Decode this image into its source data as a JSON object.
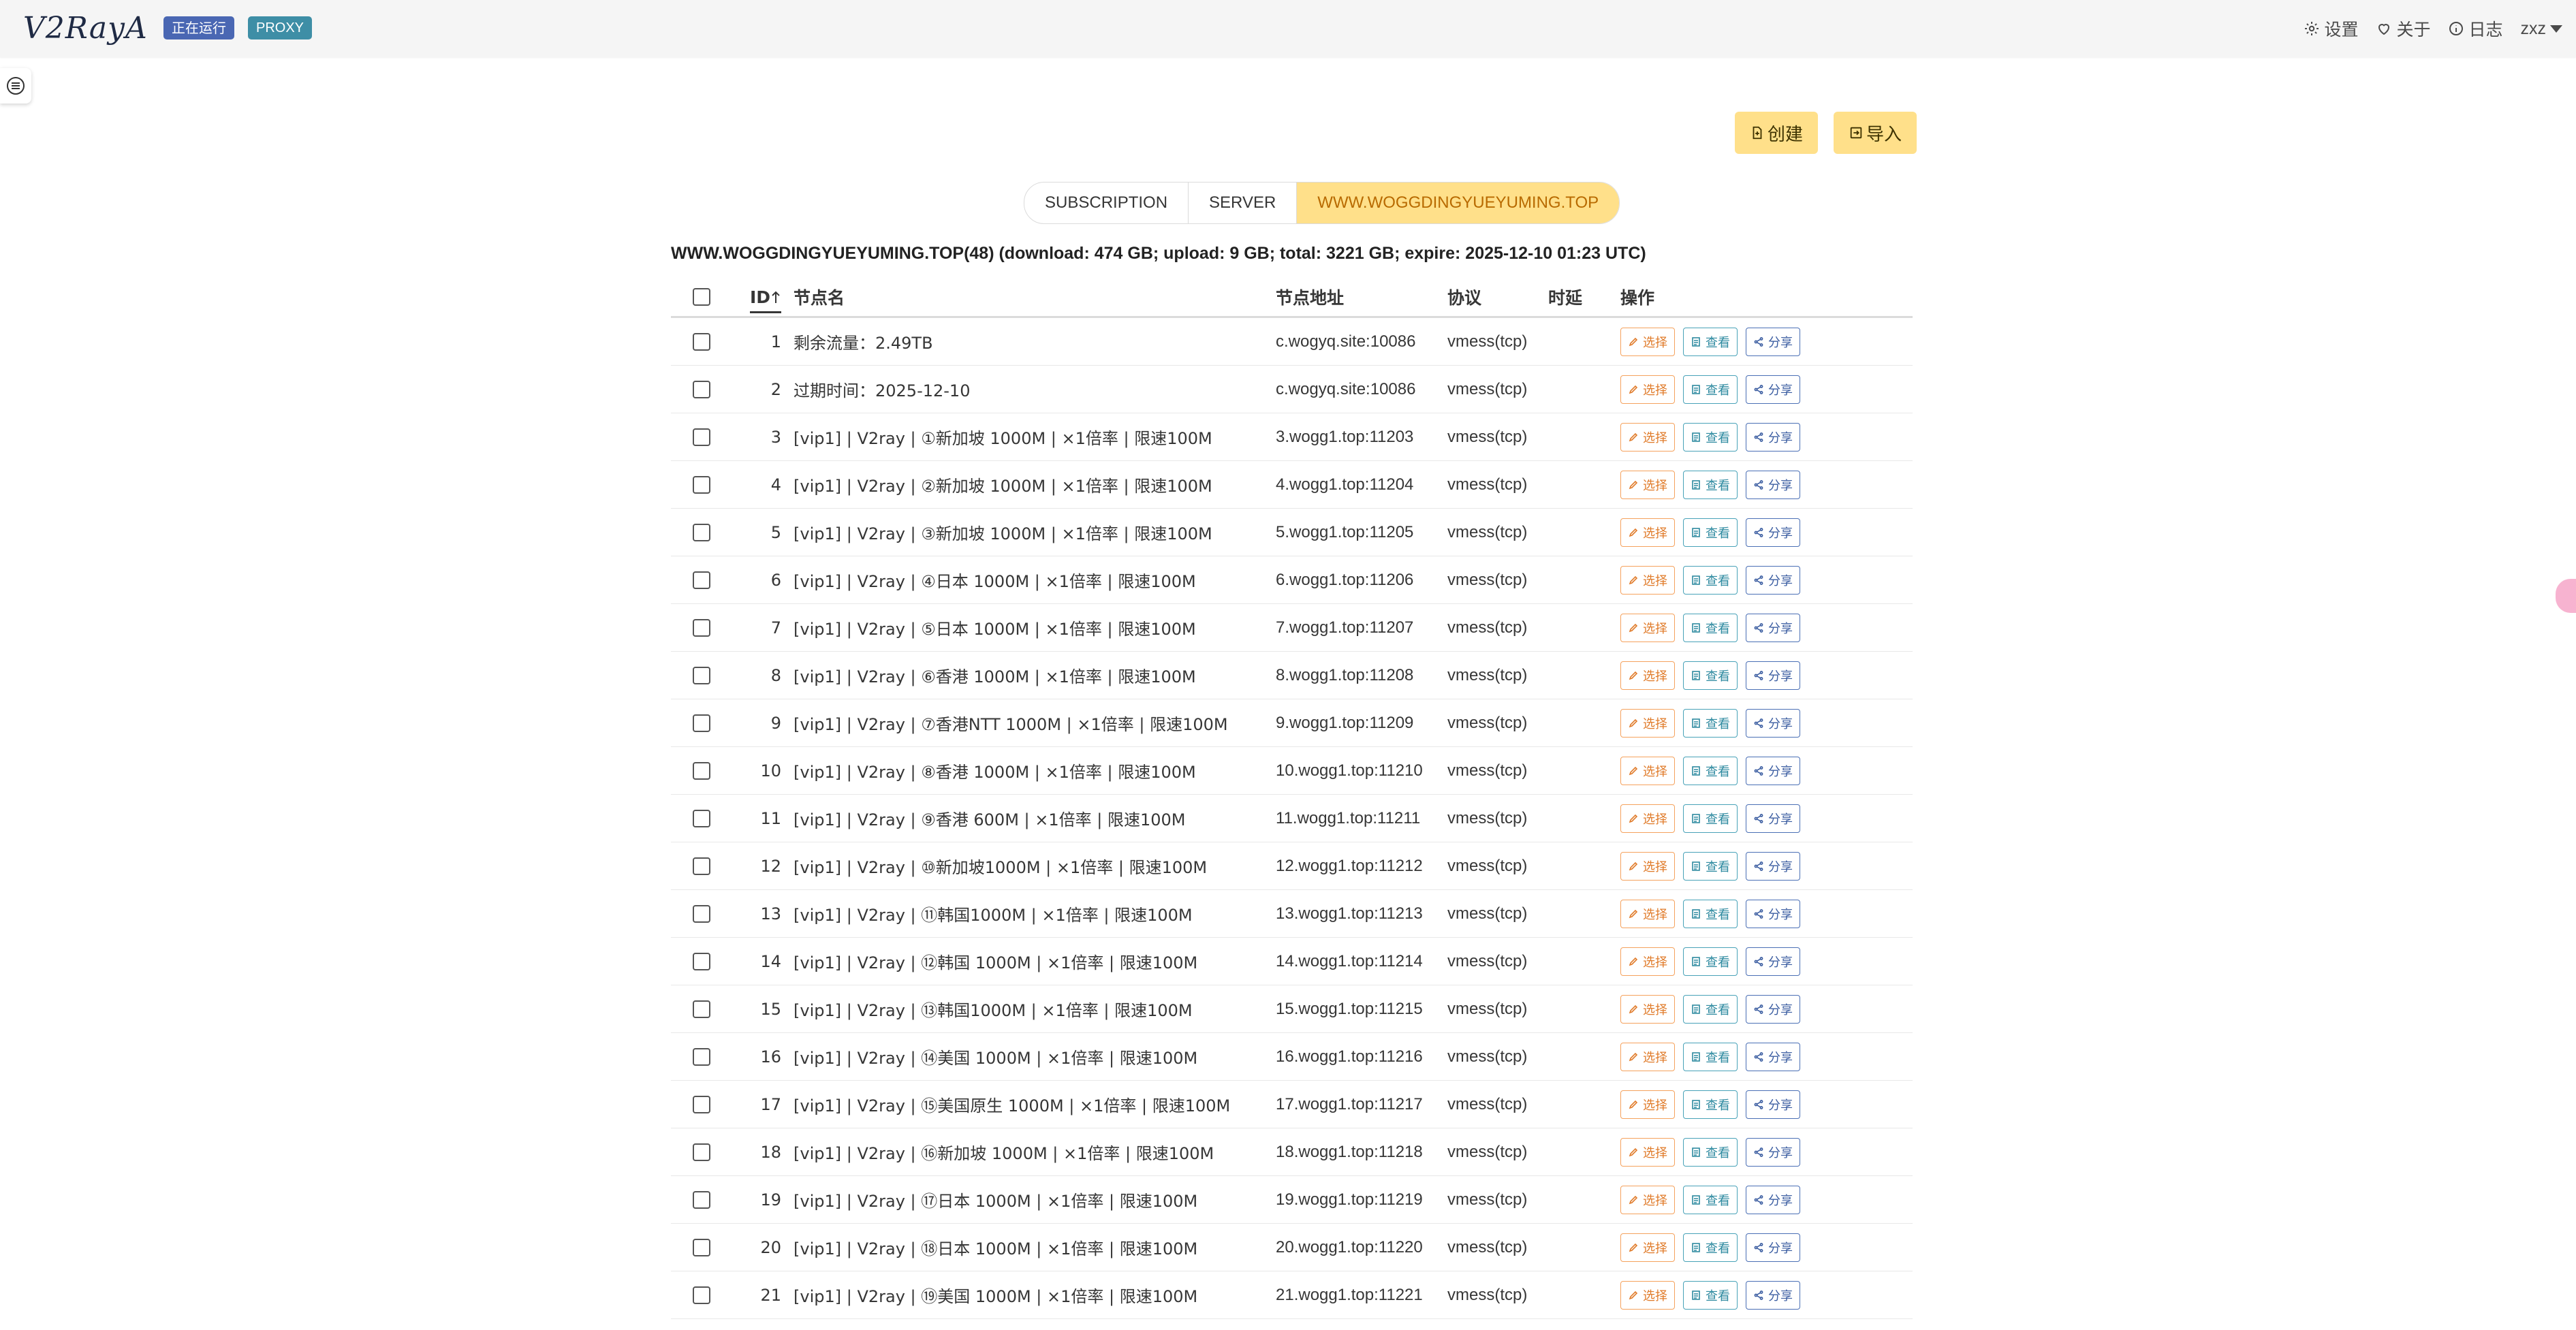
{
  "navbar": {
    "brand": "V2RayA",
    "status_tag": "正在运行",
    "mode_tag": "PROXY",
    "settings_label": "设置",
    "about_label": "关于",
    "log_label": "日志",
    "user_label": "zxz"
  },
  "toolbar": {
    "create_label": "创建",
    "import_label": "导入"
  },
  "tabs": [
    {
      "label": "SUBSCRIPTION",
      "active": false
    },
    {
      "label": "SERVER",
      "active": false
    },
    {
      "label": "WWW.WOGGDINGYUEYUMING.TOP",
      "active": true
    }
  ],
  "summary": "WWW.WOGGDINGYUEYUMING.TOP(48) (download: 474 GB; upload: 9 GB; total: 3221 GB; expire: 2025-12-10 01:23 UTC)",
  "table": {
    "headers": {
      "id": "ID",
      "name": "节点名",
      "address": "节点地址",
      "protocol": "协议",
      "latency": "时延",
      "actions": "操作"
    },
    "action_labels": {
      "select": "选择",
      "view": "查看",
      "share": "分享"
    },
    "rows": [
      {
        "id": "1",
        "name": "剩余流量：2.49TB",
        "address": "c.wogyq.site:10086",
        "protocol": "vmess(tcp)"
      },
      {
        "id": "2",
        "name": "过期时间：2025-12-10",
        "address": "c.wogyq.site:10086",
        "protocol": "vmess(tcp)"
      },
      {
        "id": "3",
        "name": "[vip1] | V2ray | ①新加坡 1000M | ×1倍率 | 限速100M",
        "address": "3.wogg1.top:11203",
        "protocol": "vmess(tcp)"
      },
      {
        "id": "4",
        "name": "[vip1] | V2ray | ②新加坡 1000M | ×1倍率 | 限速100M",
        "address": "4.wogg1.top:11204",
        "protocol": "vmess(tcp)"
      },
      {
        "id": "5",
        "name": "[vip1] | V2ray | ③新加坡 1000M | ×1倍率 | 限速100M",
        "address": "5.wogg1.top:11205",
        "protocol": "vmess(tcp)"
      },
      {
        "id": "6",
        "name": "[vip1] | V2ray | ④日本 1000M | ×1倍率 | 限速100M",
        "address": "6.wogg1.top:11206",
        "protocol": "vmess(tcp)"
      },
      {
        "id": "7",
        "name": "[vip1] | V2ray | ⑤日本 1000M | ×1倍率 | 限速100M",
        "address": "7.wogg1.top:11207",
        "protocol": "vmess(tcp)"
      },
      {
        "id": "8",
        "name": "[vip1] | V2ray | ⑥香港 1000M | ×1倍率 | 限速100M",
        "address": "8.wogg1.top:11208",
        "protocol": "vmess(tcp)"
      },
      {
        "id": "9",
        "name": "[vip1] | V2ray | ⑦香港NTT 1000M | ×1倍率 | 限速100M",
        "address": "9.wogg1.top:11209",
        "protocol": "vmess(tcp)"
      },
      {
        "id": "10",
        "name": "[vip1] | V2ray | ⑧香港 1000M | ×1倍率 | 限速100M",
        "address": "10.wogg1.top:11210",
        "protocol": "vmess(tcp)"
      },
      {
        "id": "11",
        "name": "[vip1] | V2ray | ⑨香港 600M | ×1倍率 | 限速100M",
        "address": "11.wogg1.top:11211",
        "protocol": "vmess(tcp)"
      },
      {
        "id": "12",
        "name": "[vip1] | V2ray | ⑩新加坡1000M | ×1倍率 | 限速100M",
        "address": "12.wogg1.top:11212",
        "protocol": "vmess(tcp)"
      },
      {
        "id": "13",
        "name": "[vip1] | V2ray | ⑪韩国1000M | ×1倍率 | 限速100M",
        "address": "13.wogg1.top:11213",
        "protocol": "vmess(tcp)"
      },
      {
        "id": "14",
        "name": "[vip1] | V2ray | ⑫韩国 1000M | ×1倍率 | 限速100M",
        "address": "14.wogg1.top:11214",
        "protocol": "vmess(tcp)"
      },
      {
        "id": "15",
        "name": "[vip1] | V2ray | ⑬韩国1000M | ×1倍率 | 限速100M",
        "address": "15.wogg1.top:11215",
        "protocol": "vmess(tcp)"
      },
      {
        "id": "16",
        "name": "[vip1] | V2ray | ⑭美国 1000M | ×1倍率 | 限速100M",
        "address": "16.wogg1.top:11216",
        "protocol": "vmess(tcp)"
      },
      {
        "id": "17",
        "name": "[vip1] | V2ray | ⑮美国原生 1000M | ×1倍率 | 限速100M",
        "address": "17.wogg1.top:11217",
        "protocol": "vmess(tcp)"
      },
      {
        "id": "18",
        "name": "[vip1] | V2ray | ⑯新加坡 1000M | ×1倍率 | 限速100M",
        "address": "18.wogg1.top:11218",
        "protocol": "vmess(tcp)"
      },
      {
        "id": "19",
        "name": "[vip1] | V2ray | ⑰日本 1000M | ×1倍率 | 限速100M",
        "address": "19.wogg1.top:11219",
        "protocol": "vmess(tcp)"
      },
      {
        "id": "20",
        "name": "[vip1] | V2ray | ⑱日本 1000M | ×1倍率 | 限速100M",
        "address": "20.wogg1.top:11220",
        "protocol": "vmess(tcp)"
      },
      {
        "id": "21",
        "name": "[vip1] | V2ray | ⑲美国 1000M | ×1倍率 | 限速100M",
        "address": "21.wogg1.top:11221",
        "protocol": "vmess(tcp)"
      }
    ]
  },
  "colors": {
    "primary_yellow": "#ffe08a",
    "select_orange": "#e07b2a",
    "view_teal": "#2e8aa0",
    "share_blue": "#3b5da1"
  },
  "icons": {
    "settings": "gear-icon",
    "about": "heart-icon",
    "log": "info-icon",
    "create": "file-plus-icon",
    "import": "import-icon",
    "select": "pencil-icon",
    "view": "document-icon",
    "share": "share-icon",
    "sort": "arrow-up-icon"
  }
}
